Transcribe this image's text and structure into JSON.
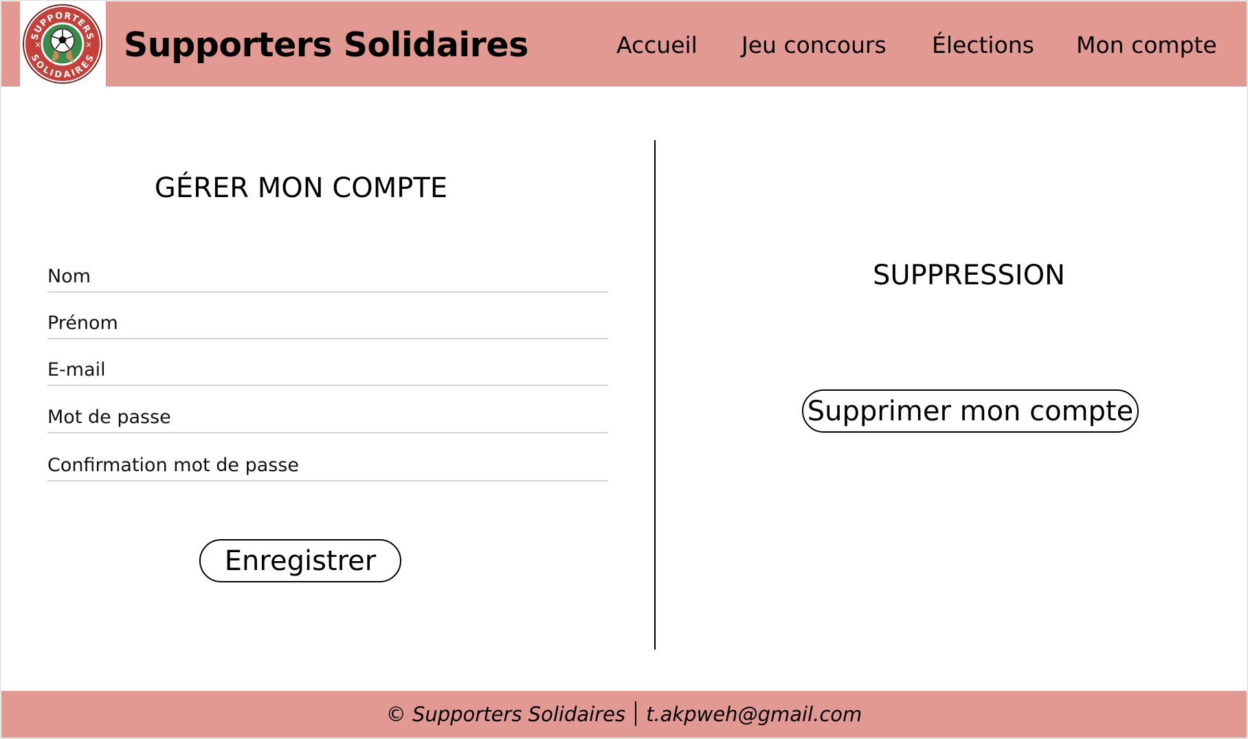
{
  "header": {
    "logo": {
      "ring_top_text": "SUPPORTERS",
      "ring_bottom_text": "SOLIDAIRES",
      "icon": "soccer-ball-hands-logo"
    },
    "brand": "Supporters Solidaires",
    "nav": [
      {
        "label": "Accueil"
      },
      {
        "label": "Jeu concours"
      },
      {
        "label": "Élections"
      },
      {
        "label": "Mon compte"
      }
    ]
  },
  "account": {
    "title": "GÉRER MON COMPTE",
    "fields": [
      {
        "placeholder": "Nom",
        "value": ""
      },
      {
        "placeholder": "Prénom",
        "value": ""
      },
      {
        "placeholder": "E-mail",
        "value": ""
      },
      {
        "placeholder": "Mot de passe",
        "value": ""
      },
      {
        "placeholder": "Confirmation mot de passe",
        "value": ""
      }
    ],
    "save_label": "Enregistrer"
  },
  "deletion": {
    "title": "SUPPRESSION",
    "delete_label": "Supprimer mon compte"
  },
  "footer": {
    "copyright": "© Supporters Solidaires",
    "email": "t.akpweh@gmail.com"
  },
  "colors": {
    "header_bg": "#e29992",
    "footer_bg": "#e29992",
    "logo_red": "#c6403a",
    "logo_green": "#3a8a4a"
  }
}
